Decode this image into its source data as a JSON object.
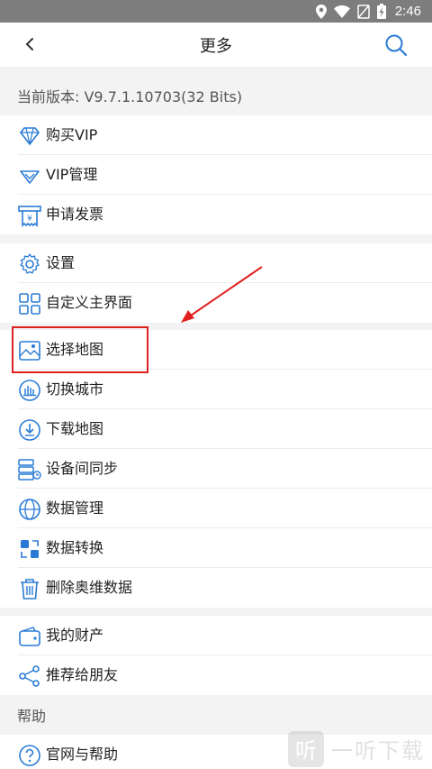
{
  "status_bar": {
    "time": "2:46"
  },
  "header": {
    "title": "更多"
  },
  "version": {
    "text": "当前版本: V9.7.1.10703(32 Bits)"
  },
  "groups": {
    "vip": [
      {
        "label": "购买VIP",
        "icon": "diamond-icon"
      },
      {
        "label": "VIP管理",
        "icon": "vip-manage-icon"
      },
      {
        "label": "申请发票",
        "icon": "invoice-icon"
      }
    ],
    "settings": [
      {
        "label": "设置",
        "icon": "gear-icon"
      },
      {
        "label": "自定义主界面",
        "icon": "custom-layout-icon"
      }
    ],
    "map": [
      {
        "label": "选择地图",
        "icon": "map-select-icon"
      },
      {
        "label": "切换城市",
        "icon": "city-switch-icon"
      },
      {
        "label": "下载地图",
        "icon": "download-map-icon"
      },
      {
        "label": "设备间同步",
        "icon": "sync-icon"
      },
      {
        "label": "数据管理",
        "icon": "globe-data-icon"
      },
      {
        "label": "数据转换",
        "icon": "data-convert-icon"
      },
      {
        "label": "删除奥维数据",
        "icon": "trash-icon"
      }
    ],
    "assets": [
      {
        "label": "我的财产",
        "icon": "wallet-icon"
      },
      {
        "label": "推荐给朋友",
        "icon": "share-icon"
      }
    ],
    "help_title": "帮助",
    "help": [
      {
        "label": "官网与帮助",
        "icon": "help-icon"
      }
    ]
  },
  "watermark": {
    "logo": "听",
    "text": "一听下载"
  },
  "colors": {
    "accent": "#2a7bd5",
    "annotation": "#e02020"
  }
}
